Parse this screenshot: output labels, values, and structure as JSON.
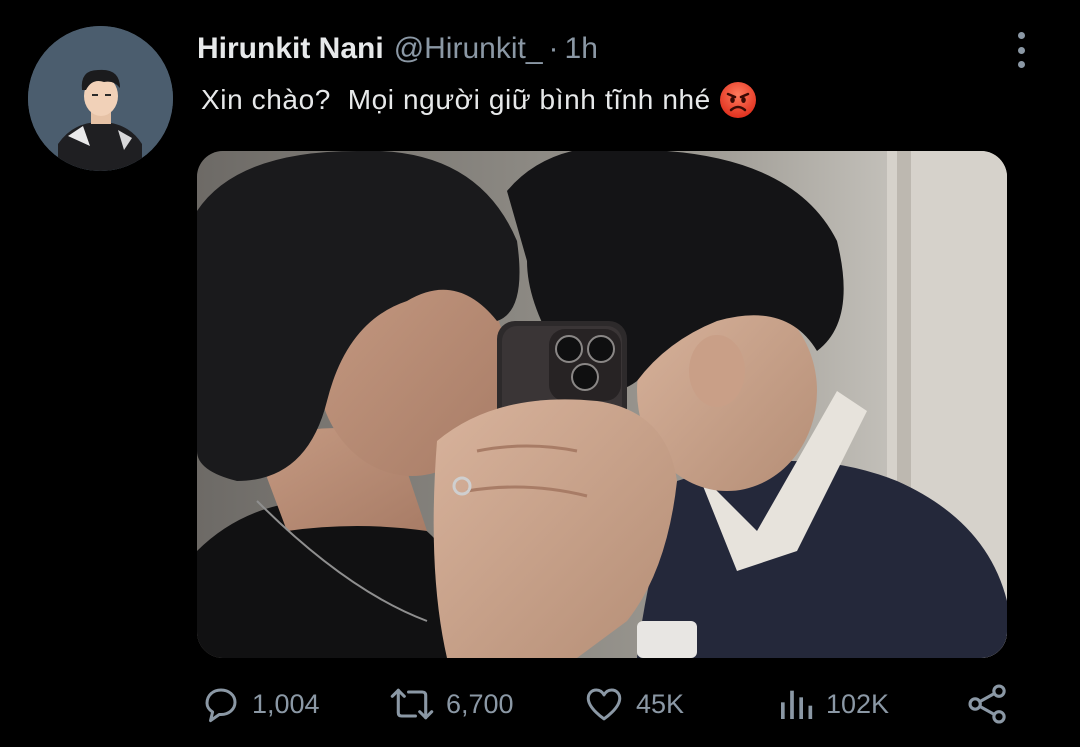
{
  "tweet": {
    "display_name": "Hirunkit Nani",
    "handle": "@Hirunkit_",
    "separator": "·",
    "time": "1h",
    "text": "Xin chào?  Mọi người giữ bình tĩnh nhé",
    "emoji": "angry-face-emoji"
  },
  "actions": {
    "replies": "1,004",
    "retweets": "6,700",
    "likes": "45K",
    "views": "102K"
  },
  "colors": {
    "background": "#000000",
    "primary_text": "#e7e9ea",
    "secondary_text": "#8b98a5",
    "avatar_bg": "#4b5d6e"
  },
  "icons": [
    "more-vertical-icon",
    "reply-icon",
    "retweet-icon",
    "like-icon",
    "views-icon",
    "share-icon"
  ]
}
